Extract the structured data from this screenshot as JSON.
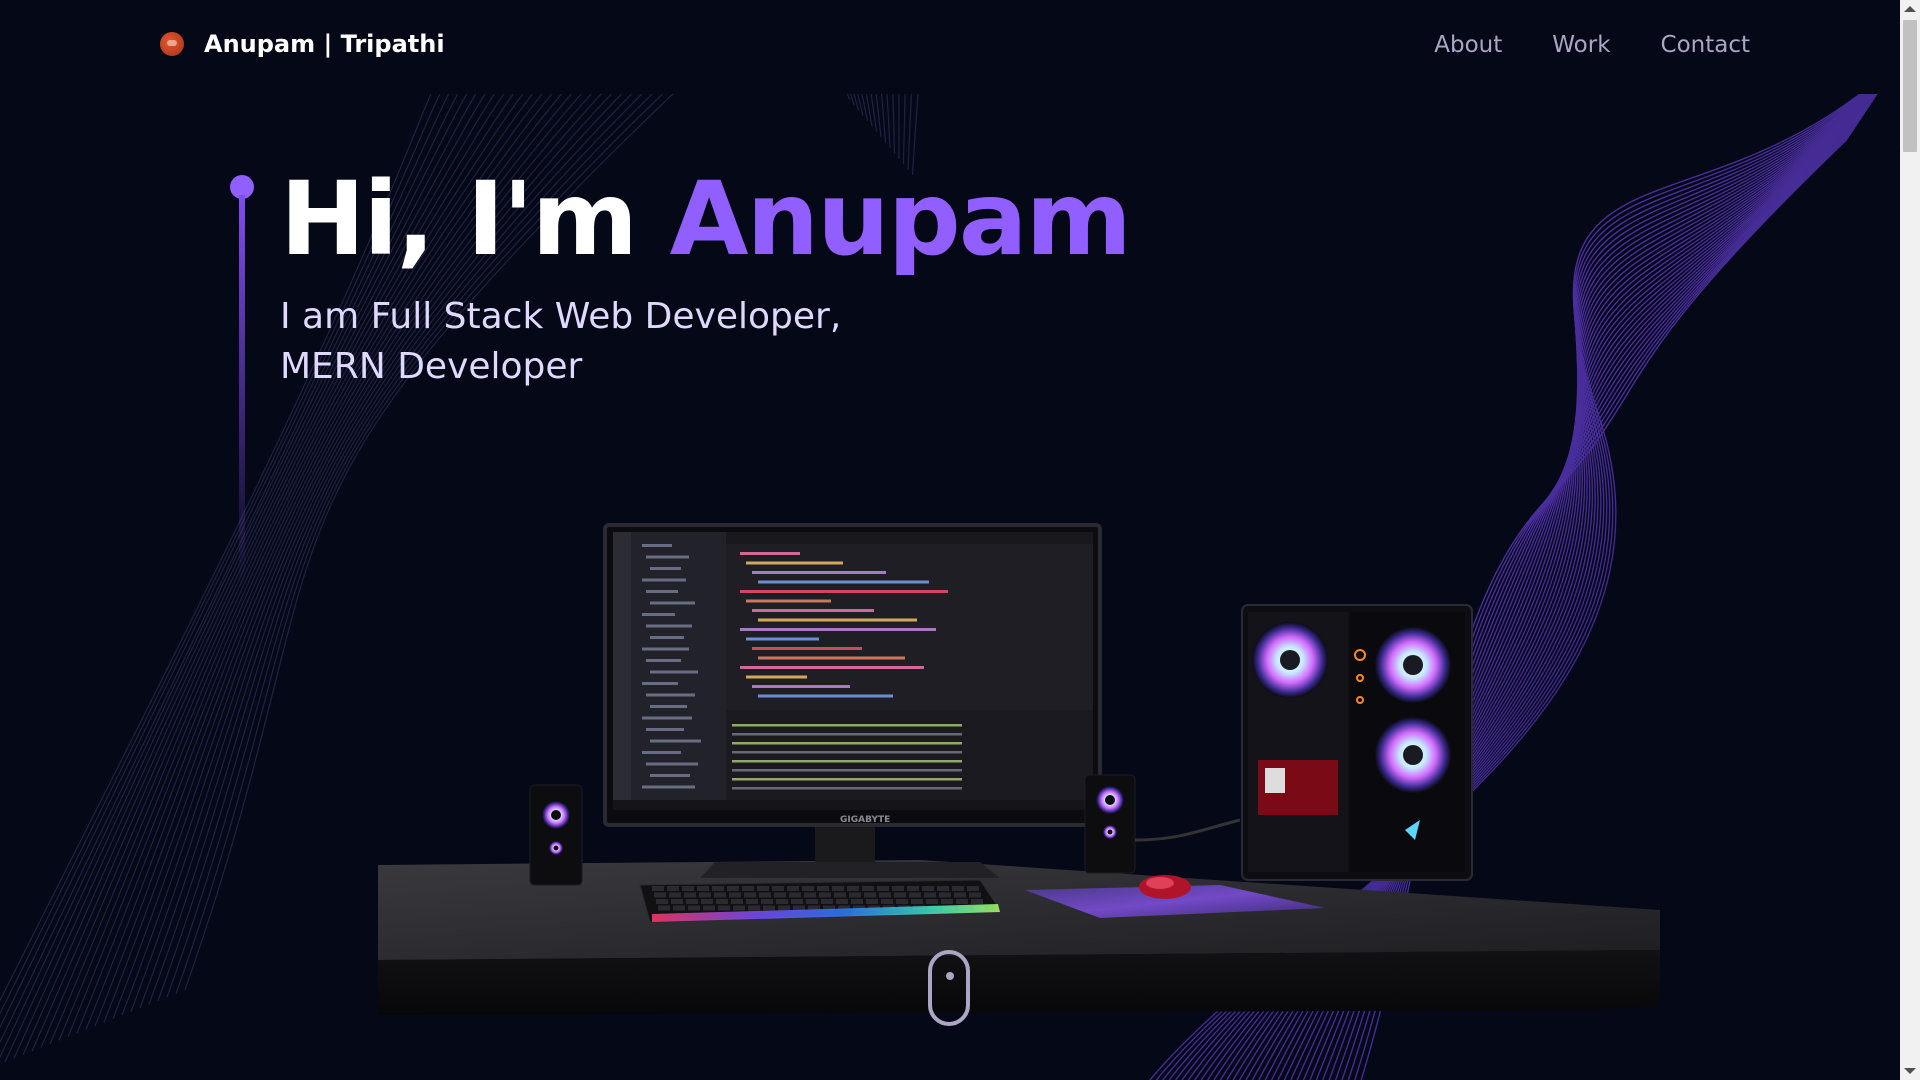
{
  "navbar": {
    "logo_icon": "planet-logo-icon",
    "logo_text": "Anupam | Tripathi",
    "links": [
      "About",
      "Work",
      "Contact"
    ]
  },
  "hero": {
    "greeting": "Hi, I'm ",
    "name": "Anupam",
    "subtitle_line1": "I am Full Stack Web Developer,",
    "subtitle_line2": "MERN Developer"
  },
  "scene": {
    "monitor_brand": "GIGABYTE",
    "icons": [
      "desktop-computer-3d-scene",
      "mouse-scroll-icon"
    ]
  },
  "colors": {
    "background": "#050816",
    "accent": "#915eff",
    "nav_text": "#aaa6c3",
    "subtitle": "#dfd9ff"
  }
}
